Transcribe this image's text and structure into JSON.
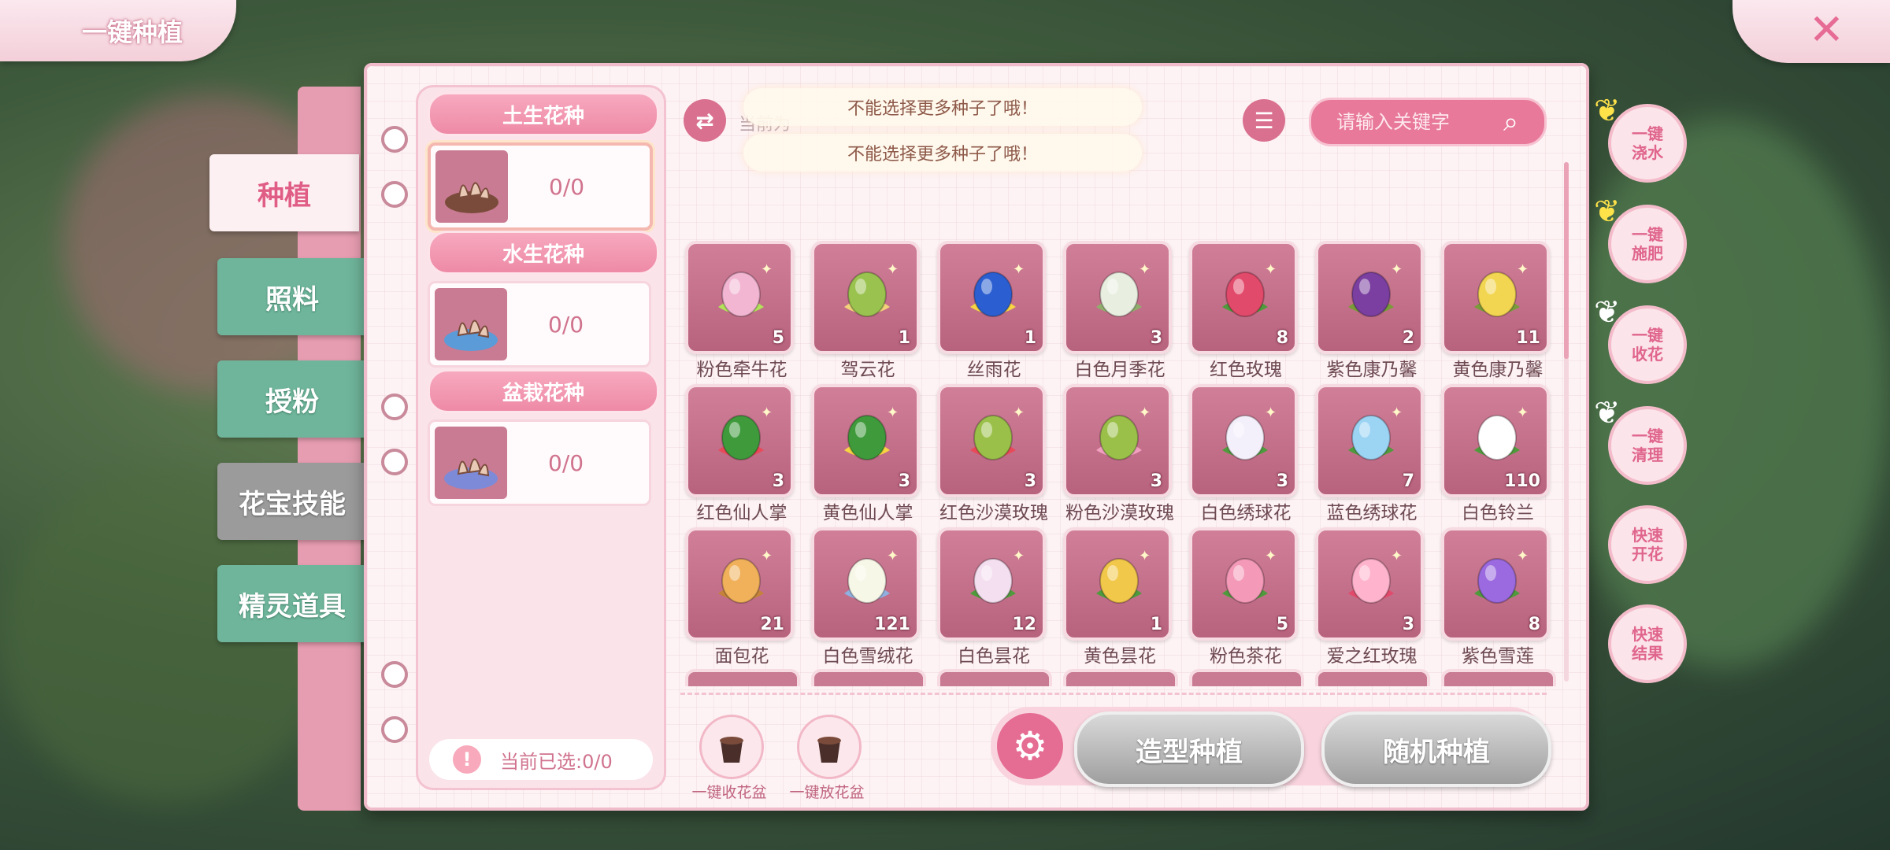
{
  "title": "一键种植",
  "tabs": [
    {
      "label": "种植",
      "state": "active"
    },
    {
      "label": "照料",
      "state": "green"
    },
    {
      "label": "授粉",
      "state": "green"
    },
    {
      "label": "花宝技能",
      "state": "gray"
    },
    {
      "label": "精灵道具",
      "state": "green"
    }
  ],
  "categories": [
    {
      "header": "土生花种",
      "count": "0/0",
      "selected": true,
      "water": "#7a4b3a"
    },
    {
      "header": "水生花种",
      "count": "0/0",
      "selected": false,
      "water": "#5b9bd8"
    },
    {
      "header": "盆栽花种",
      "count": "0/0",
      "selected": false,
      "water": "#7d8ad8"
    }
  ],
  "current_selected": "当前已选:0/0",
  "hint_text": "当前为",
  "search": {
    "placeholder": "请输入关键字"
  },
  "toasts": [
    "不能选择更多种子了哦！",
    "不能选择更多种子了哦！"
  ],
  "seeds": [
    {
      "name": "粉色牵牛花",
      "qty": "5",
      "color": "#f2b6d3",
      "accent": "#b2e35a"
    },
    {
      "name": "驾云花",
      "qty": "1",
      "color": "#9ac24f",
      "accent": "#f2d27a"
    },
    {
      "name": "丝雨花",
      "qty": "1",
      "color": "#2b5fd1",
      "accent": "#f6d443"
    },
    {
      "name": "白色月季花",
      "qty": "3",
      "color": "#e8efe0",
      "accent": "#8fae6c"
    },
    {
      "name": "红色玫瑰",
      "qty": "8",
      "color": "#e24a6b",
      "accent": "#4f9a3c"
    },
    {
      "name": "紫色康乃馨",
      "qty": "2",
      "color": "#7a3fa0",
      "accent": "#7a9b3a"
    },
    {
      "name": "黄色康乃馨",
      "qty": "11",
      "color": "#f2d651",
      "accent": "#7a9b3a"
    },
    {
      "name": "红色仙人掌",
      "qty": "3",
      "color": "#3f9a3c",
      "accent": "#e84a5a"
    },
    {
      "name": "黄色仙人掌",
      "qty": "3",
      "color": "#3f9a3c",
      "accent": "#f6d443"
    },
    {
      "name": "红色沙漠玫瑰",
      "qty": "3",
      "color": "#9bc04a",
      "accent": "#e84a5a"
    },
    {
      "name": "粉色沙漠玫瑰",
      "qty": "3",
      "color": "#9bc04a",
      "accent": "#f2a0c0"
    },
    {
      "name": "白色绣球花",
      "qty": "3",
      "color": "#f4f0fb",
      "accent": "#4f9a3c"
    },
    {
      "name": "蓝色绣球花",
      "qty": "7",
      "color": "#9cd4f4",
      "accent": "#4f9a3c"
    },
    {
      "name": "白色铃兰",
      "qty": "110",
      "color": "#ffffff",
      "accent": "#4f9a3c"
    },
    {
      "name": "面包花",
      "qty": "21",
      "color": "#f0b15a",
      "accent": "#c4823a"
    },
    {
      "name": "白色雪绒花",
      "qty": "121",
      "color": "#f7f7e8",
      "accent": "#8fb0e0"
    },
    {
      "name": "白色昙花",
      "qty": "12",
      "color": "#f4dff0",
      "accent": "#4f9a3c"
    },
    {
      "name": "黄色昙花",
      "qty": "1",
      "color": "#f2c84a",
      "accent": "#4f9a3c"
    },
    {
      "name": "粉色茶花",
      "qty": "5",
      "color": "#f49ab8",
      "accent": "#4f9a3c"
    },
    {
      "name": "爱之红玫瑰",
      "qty": "3",
      "color": "#ffb3cc",
      "accent": "#e24a6b"
    },
    {
      "name": "紫色雪莲",
      "qty": "8",
      "color": "#9b6ae0",
      "accent": "#4f9a3c"
    }
  ],
  "pots": [
    {
      "label": "一键收花盆"
    },
    {
      "label": "一键放花盆"
    }
  ],
  "buttons": {
    "shape_plant": "造型种植",
    "random_plant": "随机种植"
  },
  "actions": [
    {
      "label": "一键\n浇水"
    },
    {
      "label": "一键\n施肥"
    },
    {
      "label": "一键\n收花"
    },
    {
      "label": "一键\n清理"
    },
    {
      "label": "快速\n开花"
    },
    {
      "label": "快速\n结果"
    }
  ],
  "colors": {
    "accent": "#e56c92",
    "panel": "#fdf3f5",
    "tab_green": "#6fb59b",
    "tab_gray": "#9b9b9b"
  }
}
